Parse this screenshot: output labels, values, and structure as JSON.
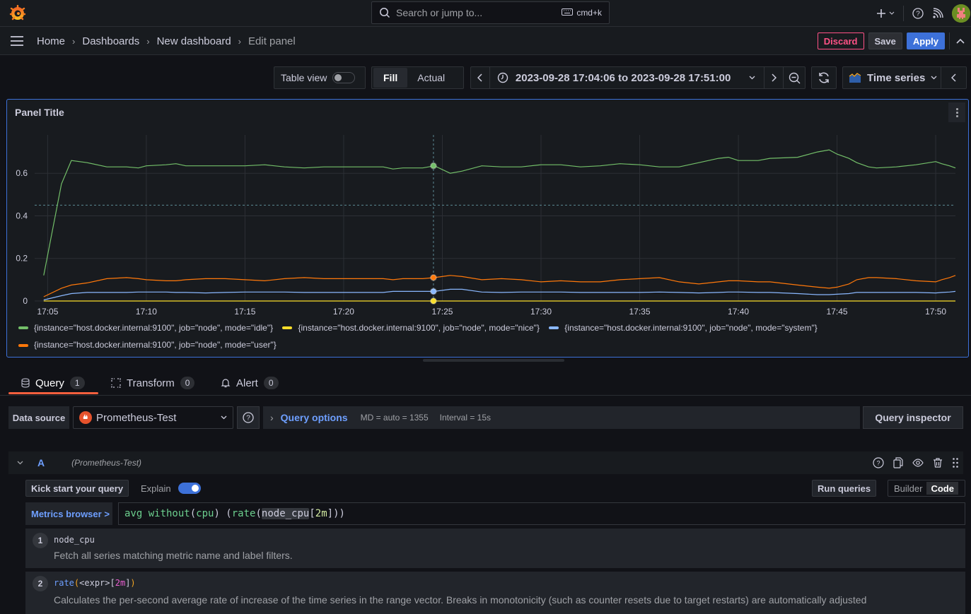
{
  "topbar": {
    "search_placeholder": "Search or jump to...",
    "search_shortcut": "cmd+k",
    "icons": [
      "grafana-logo-icon",
      "search-icon",
      "keyboard-icon",
      "plus-icon",
      "chevron-down-icon",
      "help-icon",
      "rss-icon",
      "user-avatar"
    ]
  },
  "breadcrumb": {
    "items": [
      "Home",
      "Dashboards",
      "New dashboard",
      "Edit panel"
    ]
  },
  "actions": {
    "discard": "Discard",
    "save": "Save",
    "apply": "Apply"
  },
  "toolbar": {
    "table_view_label": "Table view",
    "table_view_on": false,
    "fill_label": "Fill",
    "actual_label": "Actual",
    "time_from": "2023-09-28 17:04:06",
    "time_to_word": "to",
    "time_to": "2023-09-28 17:51:00",
    "visualization": "Time series"
  },
  "panel": {
    "title": "Panel Title"
  },
  "chart_data": {
    "type": "line",
    "title": "Panel Title",
    "xlabel": "",
    "ylabel": "",
    "x_ticks": [
      "17:05",
      "17:10",
      "17:15",
      "17:20",
      "17:25",
      "17:30",
      "17:35",
      "17:40",
      "17:45",
      "17:50"
    ],
    "y_ticks": [
      "0",
      "0.2",
      "0.4",
      "0.6"
    ],
    "ylim": [
      0,
      0.78
    ],
    "x_range_minutes": [
      4.7,
      51.0
    ],
    "grid": true,
    "legend_position": "bottom",
    "crosshair_x_minute": 24.55,
    "threshold_dashed_y": 0.45,
    "x_minutes": [
      4.8,
      5.7,
      6.2,
      7,
      8,
      9,
      9.6,
      10,
      11,
      11.5,
      12,
      13,
      14,
      15,
      16,
      17,
      18,
      19,
      20,
      21,
      22,
      22.5,
      23,
      24,
      24.6,
      25.4,
      26,
      27,
      28,
      29,
      30,
      31,
      32,
      33,
      34,
      35,
      36,
      37,
      38,
      39,
      39.5,
      40,
      41,
      41.6,
      43,
      44,
      44.6,
      45,
      45.6,
      46,
      46.6,
      47,
      48,
      49,
      50,
      50.3,
      50.7,
      51
    ],
    "series": [
      {
        "name": "{instance=\"host.docker.internal:9100\", job=\"node\", mode=\"idle\"}",
        "color": "#73bf69",
        "values": [
          0.12,
          0.55,
          0.66,
          0.65,
          0.63,
          0.63,
          0.625,
          0.635,
          0.64,
          0.645,
          0.635,
          0.635,
          0.635,
          0.635,
          0.64,
          0.63,
          0.625,
          0.63,
          0.63,
          0.63,
          0.63,
          0.62,
          0.625,
          0.625,
          0.635,
          0.6,
          0.61,
          0.635,
          0.63,
          0.63,
          0.64,
          0.64,
          0.63,
          0.635,
          0.645,
          0.64,
          0.63,
          0.63,
          0.65,
          0.67,
          0.675,
          0.66,
          0.66,
          0.67,
          0.675,
          0.7,
          0.71,
          0.69,
          0.67,
          0.65,
          0.63,
          0.625,
          0.63,
          0.64,
          0.655,
          0.645,
          0.635,
          0.625
        ]
      },
      {
        "name": "{instance=\"host.docker.internal:9100\", job=\"node\", mode=\"nice\"}",
        "color": "#fade2a",
        "values": [
          0,
          0,
          0,
          0,
          0,
          0,
          0,
          0,
          0,
          0,
          0,
          0,
          0,
          0,
          0,
          0,
          0,
          0,
          0,
          0,
          0,
          0,
          0,
          0,
          0,
          0,
          0,
          0,
          0,
          0,
          0,
          0,
          0,
          0,
          0,
          0,
          0,
          0,
          0,
          0,
          0,
          0,
          0,
          0,
          0,
          0,
          0,
          0,
          0,
          0,
          0,
          0,
          0,
          0,
          0,
          0,
          0,
          0
        ]
      },
      {
        "name": "{instance=\"host.docker.internal:9100\", job=\"node\", mode=\"system\"}",
        "color": "#8ab8ff",
        "values": [
          0.005,
          0.025,
          0.035,
          0.04,
          0.04,
          0.04,
          0.042,
          0.042,
          0.042,
          0.04,
          0.04,
          0.038,
          0.04,
          0.042,
          0.042,
          0.042,
          0.04,
          0.04,
          0.04,
          0.04,
          0.04,
          0.045,
          0.045,
          0.045,
          0.045,
          0.055,
          0.055,
          0.042,
          0.04,
          0.042,
          0.042,
          0.042,
          0.04,
          0.04,
          0.04,
          0.04,
          0.042,
          0.04,
          0.038,
          0.04,
          0.042,
          0.042,
          0.04,
          0.04,
          0.035,
          0.03,
          0.03,
          0.032,
          0.035,
          0.04,
          0.04,
          0.04,
          0.04,
          0.04,
          0.038,
          0.04,
          0.042,
          0.045
        ]
      },
      {
        "name": "{instance=\"host.docker.internal:9100\", job=\"node\", mode=\"user\"}",
        "color": "#ff780a",
        "values": [
          0.02,
          0.06,
          0.075,
          0.085,
          0.105,
          0.11,
          0.105,
          0.1,
          0.095,
          0.095,
          0.1,
          0.105,
          0.105,
          0.1,
          0.095,
          0.105,
          0.11,
          0.105,
          0.105,
          0.105,
          0.105,
          0.1,
          0.105,
          0.105,
          0.11,
          0.12,
          0.115,
          0.1,
          0.105,
          0.1,
          0.09,
          0.095,
          0.09,
          0.09,
          0.1,
          0.105,
          0.11,
          0.09,
          0.08,
          0.09,
          0.095,
          0.095,
          0.09,
          0.09,
          0.075,
          0.065,
          0.06,
          0.065,
          0.08,
          0.1,
          0.11,
          0.11,
          0.105,
          0.095,
          0.09,
          0.1,
          0.11,
          0.12
        ]
      }
    ]
  },
  "tabs": [
    {
      "label": "Query",
      "count": "1",
      "active": true
    },
    {
      "label": "Transform",
      "count": "0",
      "active": false
    },
    {
      "label": "Alert",
      "count": "0",
      "active": false
    }
  ],
  "datasource": {
    "label": "Data source",
    "selected": "Prometheus-Test",
    "query_options_label": "Query options",
    "md": "MD = auto = 1355",
    "interval": "Interval = 15s",
    "query_inspector": "Query inspector"
  },
  "query": {
    "ref_id": "A",
    "datasource_name": "(Prometheus-Test)",
    "kick_start": "Kick start your query",
    "explain_label": "Explain",
    "explain_on": true,
    "run_queries": "Run queries",
    "mode_builder": "Builder",
    "mode_code": "Code",
    "metrics_browser": "Metrics browser >",
    "expr_parts": {
      "p1": "avg without",
      "p2": "(",
      "p3": "cpu",
      "p4": ") (",
      "p5": "rate",
      "p6": "(",
      "p7": "node_cpu",
      "p8": "[",
      "p9": "2m",
      "p10": "]))"
    },
    "explain_steps": [
      {
        "n": "1",
        "code": "node_cpu",
        "desc": "Fetch all series matching metric name and label filters."
      },
      {
        "n": "2",
        "code_fn": "rate",
        "code_open": "(",
        "code_expr": "<expr>",
        "code_lb": "[",
        "code_range": "2m",
        "code_rb": "]",
        "code_close": ")",
        "desc": "Calculates the per-second average rate of increase of the time series in the range vector. Breaks in monotonicity (such as counter resets due to target restarts) are automatically adjusted"
      }
    ]
  }
}
